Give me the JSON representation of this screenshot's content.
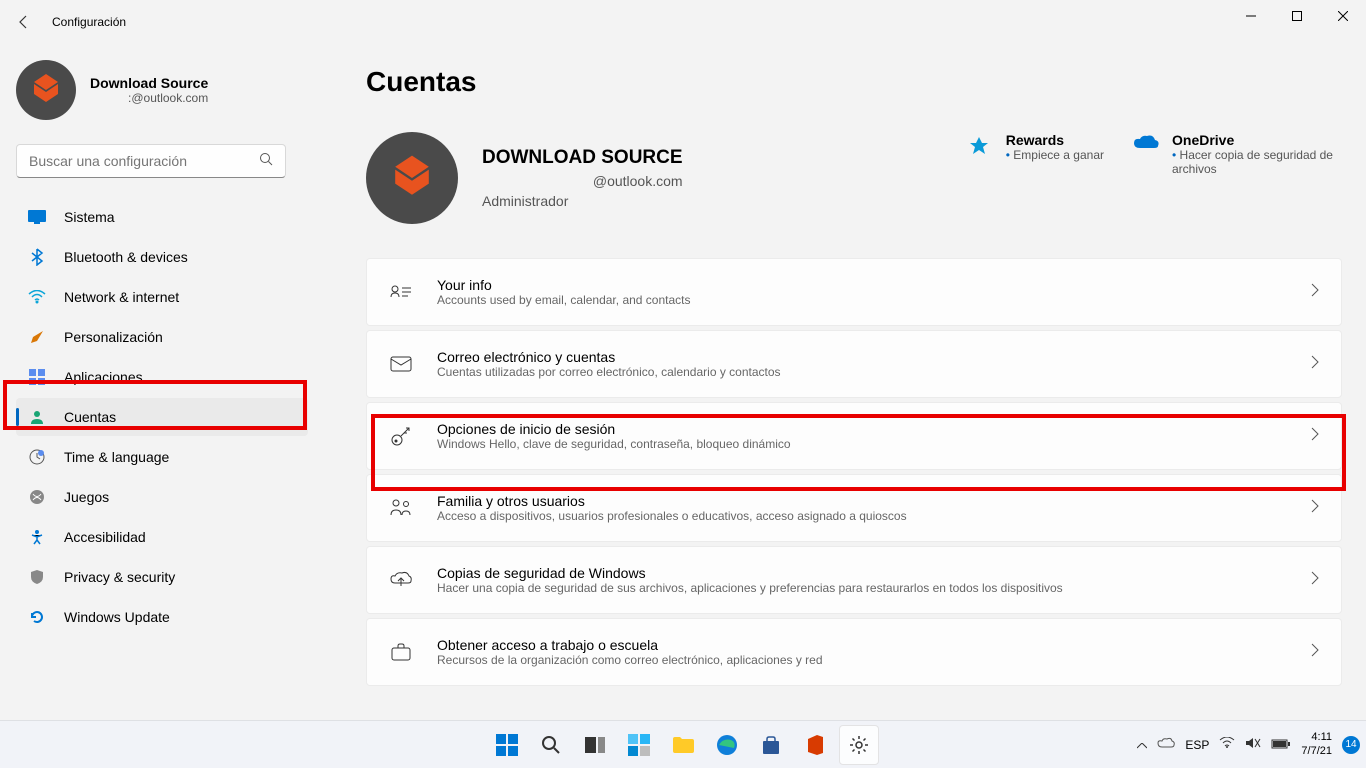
{
  "window": {
    "title": "Configuración"
  },
  "profile": {
    "name": "Download Source",
    "email": ":@outlook.com"
  },
  "search": {
    "placeholder": "Buscar una configuración"
  },
  "nav": {
    "items": [
      {
        "label": "Sistema",
        "icon": "display"
      },
      {
        "label": "Bluetooth & devices",
        "icon": "bluetooth"
      },
      {
        "label": "Network & internet",
        "icon": "wifi"
      },
      {
        "label": "Personalización",
        "icon": "brush"
      },
      {
        "label": "Aplicaciones",
        "icon": "apps"
      },
      {
        "label": "Cuentas",
        "icon": "person",
        "active": true
      },
      {
        "label": "Time & language",
        "icon": "clock"
      },
      {
        "label": "Juegos",
        "icon": "xbox"
      },
      {
        "label": "Accesibilidad",
        "icon": "accessibility"
      },
      {
        "label": "Privacy & security",
        "icon": "shield"
      },
      {
        "label": "Windows Update",
        "icon": "update"
      }
    ]
  },
  "page": {
    "title": "Cuentas"
  },
  "account": {
    "name": "DOWNLOAD SOURCE",
    "email": "@outlook.com",
    "role": "Administrador"
  },
  "rewards": {
    "title": "Rewards",
    "sub": "Empiece a ganar"
  },
  "onedrive": {
    "title": "OneDrive",
    "sub": "Hacer copia de seguridad de archivos"
  },
  "settings": [
    {
      "title": "Your info",
      "sub": "Accounts used by email, calendar, and contacts"
    },
    {
      "title": "Correo electrónico y cuentas",
      "sub": "Cuentas utilizadas por correo electrónico, calendario y contactos"
    },
    {
      "title": "Opciones de inicio de sesión",
      "sub": "Windows Hello, clave de seguridad, contraseña, bloqueo dinámico"
    },
    {
      "title": "Familia y otros usuarios",
      "sub": "Acceso a dispositivos, usuarios profesionales o educativos, acceso asignado a quioscos"
    },
    {
      "title": "Copias de seguridad de Windows",
      "sub": "Hacer una copia de seguridad de sus archivos, aplicaciones y preferencias para restaurarlos en todos los dispositivos"
    },
    {
      "title": "Obtener acceso a trabajo o escuela",
      "sub": "Recursos de la organización como correo electrónico, aplicaciones y red"
    }
  ],
  "taskbar": {
    "lang": "ESP",
    "time": "4:11",
    "date": "7/7/21",
    "badge": "14"
  }
}
